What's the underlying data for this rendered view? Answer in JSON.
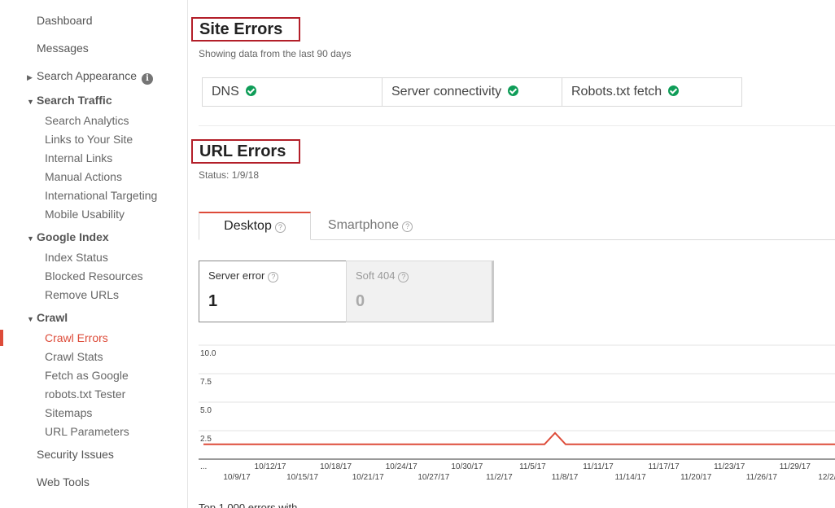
{
  "sidebar": {
    "dashboard": "Dashboard",
    "messages": "Messages",
    "search_appearance": "Search Appearance",
    "search_traffic": {
      "label": "Search Traffic",
      "items": [
        "Search Analytics",
        "Links to Your Site",
        "Internal Links",
        "Manual Actions",
        "International Targeting",
        "Mobile Usability"
      ]
    },
    "google_index": {
      "label": "Google Index",
      "items": [
        "Index Status",
        "Blocked Resources",
        "Remove URLs"
      ]
    },
    "crawl": {
      "label": "Crawl",
      "items": [
        "Crawl Errors",
        "Crawl Stats",
        "Fetch as Google",
        "robots.txt Tester",
        "Sitemaps",
        "URL Parameters"
      ],
      "active": "Crawl Errors"
    },
    "security_issues": "Security Issues",
    "web_tools": "Web Tools"
  },
  "site_errors": {
    "title": "Site Errors",
    "subtitle": "Showing data from the last 90 days",
    "checks": [
      {
        "label": "DNS",
        "status": "ok"
      },
      {
        "label": "Server connectivity",
        "status": "ok"
      },
      {
        "label": "Robots.txt fetch",
        "status": "ok"
      }
    ]
  },
  "url_errors": {
    "title": "URL Errors",
    "status": "Status: 1/9/18",
    "tabs": [
      {
        "label": "Desktop",
        "active": true
      },
      {
        "label": "Smartphone",
        "active": false
      }
    ],
    "cards": [
      {
        "label": "Server error",
        "value": "1",
        "selected": true
      },
      {
        "label": "Soft 404",
        "value": "0",
        "selected": false
      }
    ]
  },
  "chart_data": {
    "type": "line",
    "yticks": [
      "10.0",
      "7.5",
      "5.0",
      "2.5"
    ],
    "ylim": [
      0,
      10
    ],
    "xticks_upper": [
      "10/12/17",
      "10/18/17",
      "10/24/17",
      "10/30/17",
      "11/5/17",
      "11/11/17",
      "11/17/17",
      "11/23/17",
      "11/29/17"
    ],
    "xticks_lower": [
      "10/9/17",
      "10/15/17",
      "10/21/17",
      "10/27/17",
      "11/2/17",
      "11/8/17",
      "11/14/17",
      "11/20/17",
      "11/26/17",
      "12/2/"
    ],
    "first_tick": "...",
    "series": [
      {
        "color": "#dd4b39",
        "values": [
          1,
          1,
          1,
          1,
          1,
          1,
          1,
          1,
          1,
          1,
          1,
          1,
          1,
          1,
          1,
          1,
          1,
          1,
          1,
          1,
          1,
          1,
          1,
          1,
          1,
          1,
          1,
          1,
          1,
          1,
          1,
          1,
          1,
          1,
          1,
          1,
          1,
          1,
          1,
          1,
          1,
          1,
          1,
          1,
          1,
          1,
          1,
          1,
          1,
          1,
          1,
          1,
          1,
          1,
          1,
          1,
          1,
          1,
          1,
          1,
          1,
          1,
          1,
          1,
          1,
          1,
          1,
          1,
          1,
          1,
          1,
          1,
          1,
          1,
          1,
          1,
          1,
          1,
          1,
          1,
          1,
          1,
          1,
          1,
          1,
          1,
          1,
          1,
          1,
          1,
          1,
          1,
          1,
          1,
          1,
          1,
          1,
          1,
          1,
          1,
          1,
          1,
          1,
          1,
          1,
          1,
          1,
          1,
          1,
          1,
          1,
          1,
          1,
          1,
          1,
          1,
          1,
          1,
          1,
          1,
          1,
          1,
          1,
          1,
          1,
          1,
          1,
          1,
          1,
          1,
          1,
          1,
          1,
          1,
          1,
          1,
          1,
          1,
          1,
          1,
          1,
          1,
          1,
          1,
          1,
          1,
          1,
          1,
          1,
          1,
          1,
          1,
          1,
          1,
          1,
          1,
          1,
          1,
          1,
          1,
          1,
          1,
          1,
          1,
          1,
          1,
          1,
          1,
          1,
          1,
          1,
          1,
          1,
          1,
          1,
          1,
          1,
          1,
          1,
          1,
          1,
          1,
          1,
          1,
          1,
          1,
          1,
          1,
          1,
          1,
          1,
          1,
          1,
          1,
          1,
          1,
          1,
          1,
          1,
          1,
          1,
          1,
          1,
          1,
          1,
          1,
          1,
          1,
          1,
          1,
          1,
          1,
          1,
          1,
          1,
          1,
          1,
          1,
          1,
          1,
          1,
          1,
          1,
          1,
          1,
          1,
          1,
          1,
          1,
          1,
          1,
          1,
          1,
          1
        ]
      }
    ],
    "spike": {
      "value": 2
    }
  },
  "footer": {
    "cut_text": "Top 1,000 errors with"
  }
}
